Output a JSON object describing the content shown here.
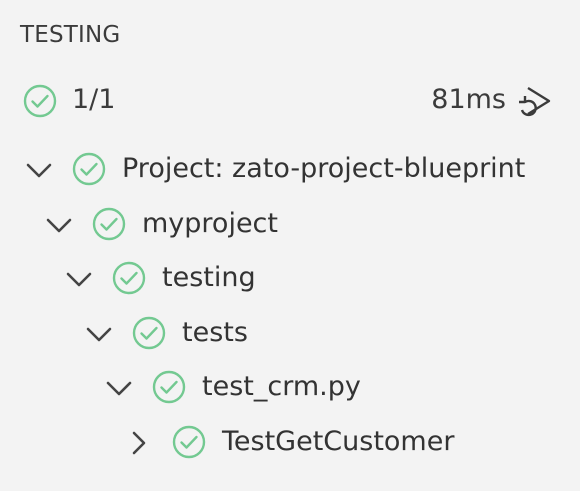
{
  "panel": {
    "title": "TESTING"
  },
  "summary": {
    "result": "1/1",
    "duration": "81ms",
    "status_icon": "pass-circle-icon",
    "rerun_icon": "rerun-icon"
  },
  "colors": {
    "pass": "#73c991",
    "text": "#333333",
    "chevron": "#444444",
    "background": "#f3f3f3"
  },
  "tree": [
    {
      "label": "Project: zato-project-blueprint",
      "expanded": true,
      "depth": 0
    },
    {
      "label": "myproject",
      "expanded": true,
      "depth": 1
    },
    {
      "label": "testing",
      "expanded": true,
      "depth": 2
    },
    {
      "label": "tests",
      "expanded": true,
      "depth": 3
    },
    {
      "label": "test_crm.py",
      "expanded": true,
      "depth": 4
    },
    {
      "label": "TestGetCustomer",
      "expanded": false,
      "depth": 5
    }
  ]
}
